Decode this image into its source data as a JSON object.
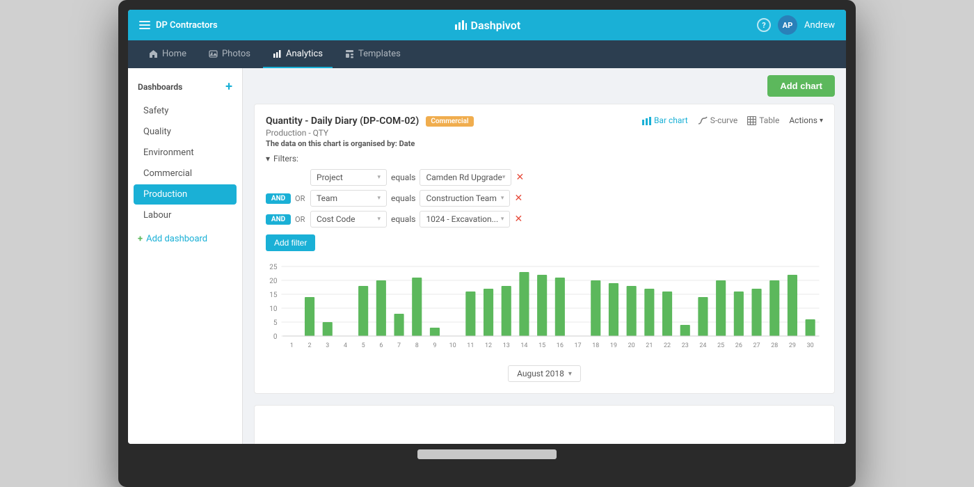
{
  "topbar": {
    "menu_icon": "hamburger-icon",
    "company_name": "DP Contractors",
    "app_name": "Dashpivot",
    "chart_icon": "bar-chart-icon",
    "help_label": "?",
    "user_initials": "AP",
    "user_name": "Andrew"
  },
  "navbar": {
    "items": [
      {
        "id": "home",
        "label": "Home",
        "icon": "home-icon",
        "active": false
      },
      {
        "id": "photos",
        "label": "Photos",
        "icon": "photos-icon",
        "active": false
      },
      {
        "id": "analytics",
        "label": "Analytics",
        "icon": "analytics-icon",
        "active": true
      },
      {
        "id": "templates",
        "label": "Templates",
        "icon": "templates-icon",
        "active": false
      }
    ]
  },
  "sidebar": {
    "header": "Dashboards",
    "add_button": "+",
    "items": [
      {
        "id": "safety",
        "label": "Safety",
        "active": false
      },
      {
        "id": "quality",
        "label": "Quality",
        "active": false
      },
      {
        "id": "environment",
        "label": "Environment",
        "active": false
      },
      {
        "id": "commercial",
        "label": "Commercial",
        "active": false
      },
      {
        "id": "production",
        "label": "Production",
        "active": true
      },
      {
        "id": "labour",
        "label": "Labour",
        "active": false
      }
    ],
    "add_dashboard_label": "Add dashboard"
  },
  "content": {
    "add_chart_btn": "Add chart",
    "chart": {
      "title": "Quantity - Daily Diary (DP-COM-02)",
      "badge": "Commercial",
      "subtitle": "Production - QTY",
      "org_text": "The data on this chart is organised by:",
      "org_field": "Date",
      "view_options": [
        {
          "id": "bar-chart",
          "label": "Bar chart",
          "active": true,
          "icon": "bar-chart-icon"
        },
        {
          "id": "s-curve",
          "label": "S-curve",
          "active": false,
          "icon": "s-curve-icon"
        },
        {
          "id": "table",
          "label": "Table",
          "active": false,
          "icon": "table-icon"
        }
      ],
      "actions_label": "Actions",
      "filters_label": "Filters:",
      "filters": [
        {
          "connector": null,
          "or_label": null,
          "field": "Project",
          "operator": "equals",
          "value": "Camden Rd Upgrade"
        },
        {
          "connector": "AND",
          "or_label": "OR",
          "field": "Team",
          "operator": "equals",
          "value": "Construction Team"
        },
        {
          "connector": "AND",
          "or_label": "OR",
          "field": "Cost Code",
          "operator": "equals",
          "value": "1024 - Excavation..."
        }
      ],
      "add_filter_label": "Add filter",
      "chart_data": {
        "y_max": 25,
        "y_labels": [
          25,
          20,
          15,
          10,
          5,
          0
        ],
        "x_labels": [
          1,
          2,
          3,
          4,
          5,
          6,
          7,
          8,
          9,
          10,
          11,
          12,
          13,
          14,
          15,
          16,
          17,
          18,
          19,
          20,
          21,
          22,
          23,
          24,
          25,
          26,
          27,
          28,
          29,
          30
        ],
        "bars": [
          0,
          14,
          5,
          0,
          18,
          20,
          8,
          21,
          3,
          0,
          16,
          17,
          18,
          23,
          22,
          21,
          0,
          20,
          19,
          18,
          17,
          16,
          4,
          14,
          20,
          16,
          17,
          20,
          22,
          6
        ],
        "bar_color": "#5cb85c"
      },
      "month_selector": "August 2018"
    }
  }
}
